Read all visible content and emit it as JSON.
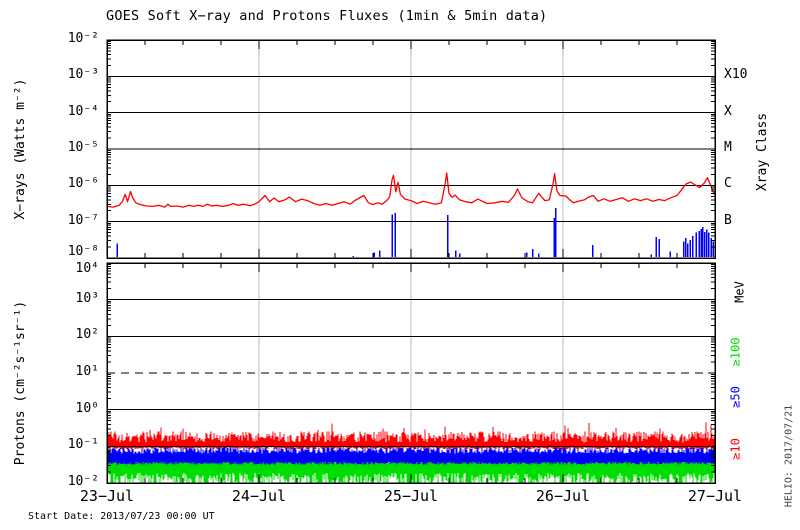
{
  "title": "GOES Soft X−ray and Protons Fluxes   (1min & 5min data)",
  "footer": {
    "start_date": "Start Date: 2013/07/23 00:00 UT"
  },
  "watermark": "HELIO: 2017/07/21",
  "colors": {
    "xray_long": "#ff0000",
    "xray_short": "#0000ff",
    "p_ge10": "#ff0000",
    "p_ge50": "#0000ff",
    "p_ge100": "#00dd00",
    "grid_day": "#b8b8b8",
    "axis": "#000000"
  },
  "chart_data": [
    {
      "type": "line",
      "panel": "xray",
      "title": "GOES Soft X−ray and Protons Fluxes   (1min & 5min data)",
      "ylabel": "X−rays (Watts m⁻²)",
      "ylim_exp": [
        -8,
        -2
      ],
      "yticks": [
        {
          "e": -2,
          "label": "10⁻²",
          "dy": 0
        },
        {
          "e": -3,
          "label": "10⁻³",
          "dy": 0
        },
        {
          "e": -4,
          "label": "10⁻⁴",
          "dy": 0
        },
        {
          "e": -5,
          "label": "10⁻⁵",
          "dy": 0
        },
        {
          "e": -6,
          "label": "10⁻⁶",
          "dy": 0
        },
        {
          "e": -7,
          "label": "10⁻⁷",
          "dy": 0
        },
        {
          "e": -8,
          "label": "10⁻⁸",
          "dy": -5
        }
      ],
      "hlines_exp": [
        -3,
        -4,
        -5,
        -6,
        -7
      ],
      "right_axis_title": "Xray Class",
      "right_labels": [
        {
          "text": "X10",
          "e": -3
        },
        {
          "text": "X",
          "e": -4
        },
        {
          "text": "M",
          "e": -5
        },
        {
          "text": "C",
          "e": -6
        },
        {
          "text": "B",
          "e": -7
        }
      ],
      "xlim_days": [
        0,
        4
      ],
      "x_ticklabels": [
        "23−Jul",
        "24−Jul",
        "25−Jul",
        "26−Jul",
        "27−Jul"
      ],
      "grid": "vertical-day-lines",
      "series": [
        {
          "name": "xray-long-1-8A",
          "type": "line",
          "color": "#ff0000",
          "points_day_log": [
            [
              0.0,
              -6.58
            ],
            [
              0.04,
              -6.6
            ],
            [
              0.08,
              -6.55
            ],
            [
              0.1,
              -6.45
            ],
            [
              0.12,
              -6.25
            ],
            [
              0.135,
              -6.45
            ],
            [
              0.155,
              -6.17
            ],
            [
              0.17,
              -6.35
            ],
            [
              0.19,
              -6.48
            ],
            [
              0.22,
              -6.53
            ],
            [
              0.26,
              -6.57
            ],
            [
              0.3,
              -6.58
            ],
            [
              0.34,
              -6.55
            ],
            [
              0.38,
              -6.6
            ],
            [
              0.4,
              -6.52
            ],
            [
              0.42,
              -6.58
            ],
            [
              0.46,
              -6.57
            ],
            [
              0.5,
              -6.6
            ],
            [
              0.54,
              -6.55
            ],
            [
              0.57,
              -6.58
            ],
            [
              0.6,
              -6.55
            ],
            [
              0.63,
              -6.58
            ],
            [
              0.66,
              -6.52
            ],
            [
              0.69,
              -6.57
            ],
            [
              0.72,
              -6.55
            ],
            [
              0.76,
              -6.58
            ],
            [
              0.8,
              -6.55
            ],
            [
              0.83,
              -6.5
            ],
            [
              0.86,
              -6.55
            ],
            [
              0.9,
              -6.52
            ],
            [
              0.94,
              -6.56
            ],
            [
              0.97,
              -6.52
            ],
            [
              1.0,
              -6.45
            ],
            [
              1.04,
              -6.28
            ],
            [
              1.07,
              -6.45
            ],
            [
              1.1,
              -6.35
            ],
            [
              1.13,
              -6.45
            ],
            [
              1.17,
              -6.4
            ],
            [
              1.2,
              -6.32
            ],
            [
              1.24,
              -6.45
            ],
            [
              1.28,
              -6.38
            ],
            [
              1.32,
              -6.42
            ],
            [
              1.36,
              -6.5
            ],
            [
              1.4,
              -6.55
            ],
            [
              1.44,
              -6.5
            ],
            [
              1.48,
              -6.55
            ],
            [
              1.52,
              -6.5
            ],
            [
              1.56,
              -6.45
            ],
            [
              1.6,
              -6.52
            ],
            [
              1.63,
              -6.42
            ],
            [
              1.66,
              -6.35
            ],
            [
              1.69,
              -6.28
            ],
            [
              1.72,
              -6.48
            ],
            [
              1.75,
              -6.53
            ],
            [
              1.78,
              -6.48
            ],
            [
              1.81,
              -6.52
            ],
            [
              1.84,
              -6.42
            ],
            [
              1.86,
              -6.32
            ],
            [
              1.875,
              -5.85
            ],
            [
              1.885,
              -5.72
            ],
            [
              1.9,
              -6.18
            ],
            [
              1.915,
              -5.92
            ],
            [
              1.93,
              -6.25
            ],
            [
              1.96,
              -6.38
            ],
            [
              2.0,
              -6.42
            ],
            [
              2.04,
              -6.5
            ],
            [
              2.08,
              -6.44
            ],
            [
              2.12,
              -6.48
            ],
            [
              2.16,
              -6.52
            ],
            [
              2.2,
              -6.48
            ],
            [
              2.225,
              -5.95
            ],
            [
              2.235,
              -5.66
            ],
            [
              2.25,
              -6.22
            ],
            [
              2.27,
              -6.33
            ],
            [
              2.29,
              -6.27
            ],
            [
              2.32,
              -6.4
            ],
            [
              2.36,
              -6.45
            ],
            [
              2.4,
              -6.48
            ],
            [
              2.44,
              -6.38
            ],
            [
              2.47,
              -6.44
            ],
            [
              2.5,
              -6.5
            ],
            [
              2.55,
              -6.48
            ],
            [
              2.6,
              -6.44
            ],
            [
              2.64,
              -6.47
            ],
            [
              2.68,
              -6.28
            ],
            [
              2.7,
              -6.1
            ],
            [
              2.73,
              -6.35
            ],
            [
              2.77,
              -6.45
            ],
            [
              2.8,
              -6.48
            ],
            [
              2.84,
              -6.22
            ],
            [
              2.88,
              -6.42
            ],
            [
              2.91,
              -6.4
            ],
            [
              2.935,
              -5.95
            ],
            [
              2.945,
              -5.68
            ],
            [
              2.96,
              -6.15
            ],
            [
              2.98,
              -6.28
            ],
            [
              3.02,
              -6.3
            ],
            [
              3.05,
              -6.42
            ],
            [
              3.07,
              -6.48
            ],
            [
              3.1,
              -6.44
            ],
            [
              3.14,
              -6.4
            ],
            [
              3.17,
              -6.32
            ],
            [
              3.2,
              -6.28
            ],
            [
              3.23,
              -6.44
            ],
            [
              3.27,
              -6.37
            ],
            [
              3.31,
              -6.44
            ],
            [
              3.35,
              -6.39
            ],
            [
              3.39,
              -6.34
            ],
            [
              3.43,
              -6.44
            ],
            [
              3.47,
              -6.37
            ],
            [
              3.51,
              -6.42
            ],
            [
              3.55,
              -6.37
            ],
            [
              3.59,
              -6.44
            ],
            [
              3.63,
              -6.39
            ],
            [
              3.67,
              -6.42
            ],
            [
              3.71,
              -6.34
            ],
            [
              3.75,
              -6.28
            ],
            [
              3.78,
              -6.12
            ],
            [
              3.81,
              -5.96
            ],
            [
              3.84,
              -5.91
            ],
            [
              3.87,
              -5.99
            ],
            [
              3.9,
              -6.06
            ],
            [
              3.93,
              -5.93
            ],
            [
              3.95,
              -5.79
            ],
            [
              3.97,
              -5.98
            ],
            [
              3.985,
              -6.15
            ],
            [
              4.0,
              -6.27
            ]
          ]
        },
        {
          "name": "xray-short-05-4A",
          "type": "spikes",
          "color": "#0000ff",
          "base_exp": -8,
          "spikes_day_log": [
            [
              0.066,
              -7.6
            ],
            [
              1.62,
              -7.95
            ],
            [
              1.757,
              -7.85
            ],
            [
              1.796,
              -7.8
            ],
            [
              1.875,
              -6.8
            ],
            [
              1.895,
              -6.76
            ],
            [
              2.243,
              -6.82
            ],
            [
              2.296,
              -7.8
            ],
            [
              2.322,
              -7.88
            ],
            [
              2.76,
              -7.85
            ],
            [
              2.8,
              -7.75
            ],
            [
              2.84,
              -7.88
            ],
            [
              2.942,
              -6.9
            ],
            [
              2.952,
              -6.62
            ],
            [
              3.197,
              -7.64
            ],
            [
              3.58,
              -7.9
            ],
            [
              3.612,
              -7.42
            ],
            [
              3.632,
              -7.48
            ],
            [
              3.704,
              -7.82
            ],
            [
              3.796,
              -7.55
            ],
            [
              3.809,
              -7.45
            ],
            [
              3.822,
              -7.6
            ],
            [
              3.836,
              -7.5
            ],
            [
              3.855,
              -7.4
            ],
            [
              3.875,
              -7.3
            ],
            [
              3.895,
              -7.25
            ],
            [
              3.908,
              -7.2
            ],
            [
              3.921,
              -7.15
            ],
            [
              3.934,
              -7.28
            ],
            [
              3.947,
              -7.22
            ],
            [
              3.96,
              -7.3
            ],
            [
              3.974,
              -7.45
            ],
            [
              3.987,
              -7.55
            ]
          ]
        }
      ]
    },
    {
      "type": "line",
      "panel": "protons",
      "ylabel": "Protons (cm⁻²s⁻¹sr⁻¹)",
      "ylim_exp": [
        -2,
        4
      ],
      "yticks": [
        {
          "e": 4,
          "label": "10⁴",
          "dy": 7
        },
        {
          "e": 3,
          "label": "10³",
          "dy": 0
        },
        {
          "e": 2,
          "label": "10²",
          "dy": 0
        },
        {
          "e": 1,
          "label": "10¹",
          "dy": 0
        },
        {
          "e": 0,
          "label": "10⁰",
          "dy": 0
        },
        {
          "e": -1,
          "label": "10⁻¹",
          "dy": 0
        },
        {
          "e": -2,
          "label": "10⁻²",
          "dy": 0
        }
      ],
      "hlines_exp": [
        3,
        2,
        0,
        -1
      ],
      "dashed_hline_exp": 1,
      "right_axis_title": "MeV",
      "right_labels": [
        {
          "text": "≥100",
          "color": "#00dd00"
        },
        {
          "text": "≥50",
          "color": "#0000ff"
        },
        {
          "text": "≥10",
          "color": "#ff0000"
        }
      ],
      "xlim_days": [
        0,
        4
      ],
      "x_ticklabels": [
        "23−Jul",
        "24−Jul",
        "25−Jul",
        "26−Jul",
        "27−Jul"
      ],
      "grid": "vertical-day-lines",
      "series": [
        {
          "name": "protons-ge10MeV",
          "type": "noise-band",
          "color": "#ff0000",
          "top_base": -0.8,
          "top_amp": 0.3,
          "spike_prob": 0.05,
          "spike_amp": 0.3,
          "bot_base": -1.02,
          "bot_amp": 0.06,
          "approx_level": 0.13
        },
        {
          "name": "protons-ge50MeV",
          "type": "noise-band",
          "color": "#0000ff",
          "top_base": -1.14,
          "top_amp": 0.2,
          "bot_base": -1.42,
          "bot_amp": 0.08,
          "approx_level": 0.05
        },
        {
          "name": "protons-ge100MeV",
          "type": "noise-band",
          "color": "#00dd00",
          "top_base": -1.38,
          "top_amp": 0.24,
          "bot_base": -1.72,
          "bot_amp": 0.38,
          "approx_level": 0.03
        }
      ]
    }
  ]
}
